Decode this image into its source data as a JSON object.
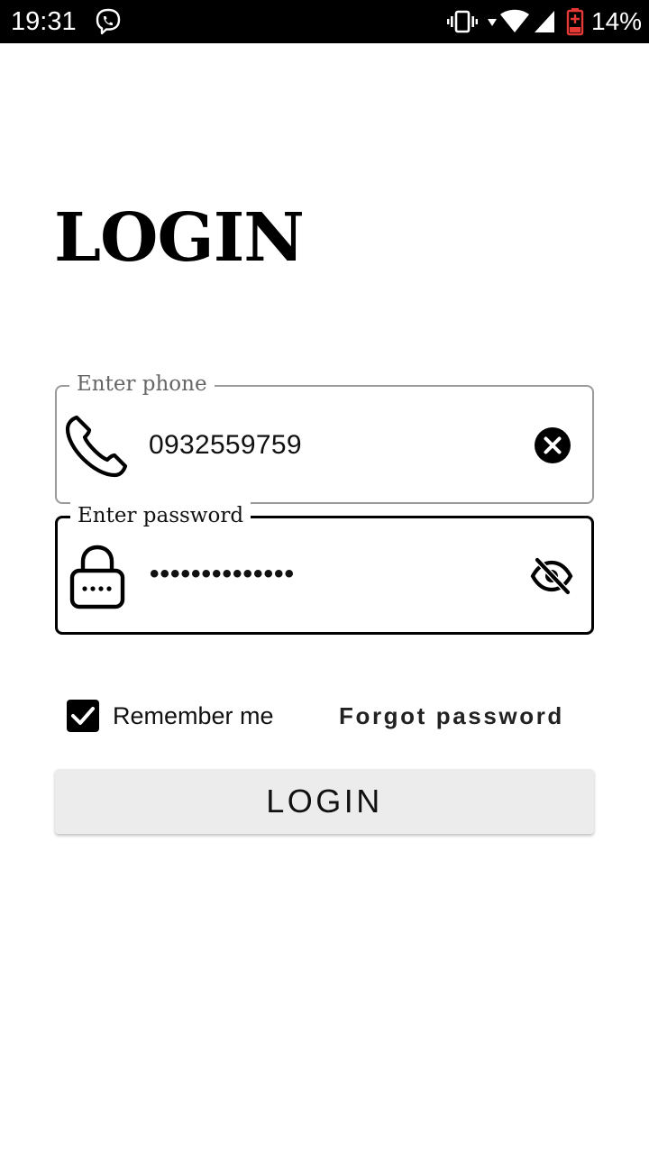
{
  "status_bar": {
    "time": "19:31",
    "battery": "14%",
    "icons": [
      "viber-icon",
      "vibrate-icon",
      "data-arrow-icon",
      "wifi-icon",
      "signal-icon",
      "battery-low-icon"
    ]
  },
  "page": {
    "title": "LOGIN"
  },
  "phone_field": {
    "label": "Enter phone",
    "value": "0932559759",
    "icon": "phone-icon",
    "action_icon": "clear-icon"
  },
  "password_field": {
    "label": "Enter password",
    "value": "••••••••••••••",
    "icon": "lock-icon",
    "action_icon": "visibility-off-icon"
  },
  "remember": {
    "label": "Remember me",
    "checked": true
  },
  "forgot_password": {
    "label": "Forgot password"
  },
  "login_button": {
    "label": "LOGIN"
  },
  "colors": {
    "status_bar_bg": "#000000",
    "background": "#ffffff",
    "button_bg": "#ececec",
    "battery_low": "#e53935",
    "phone_border": "#9a9a9a"
  }
}
